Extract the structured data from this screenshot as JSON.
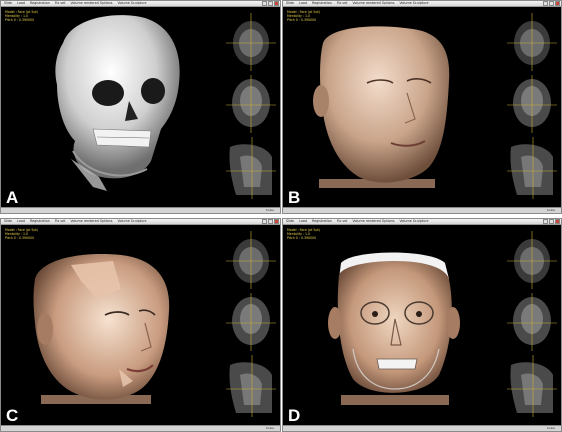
{
  "menu": [
    "Slide",
    "Load",
    "Registration",
    "Fix set",
    "Volume rendered Options",
    "Volume Sculpture"
  ],
  "panels": [
    {
      "id": "A",
      "letter": "A",
      "info": [
        "Model : Face (pt 5pt)",
        "Mentality : 1.0",
        "Pitch 0 : 0.390000"
      ],
      "scale": "Scale"
    },
    {
      "id": "B",
      "letter": "B",
      "info": [
        "Model : Face (pt 5pt)",
        "Mentality : 1.0",
        "Pitch 0 : 0.390000"
      ],
      "scale": "Scale"
    },
    {
      "id": "C",
      "letter": "C",
      "info": [
        "Model : Face (pt 5pt)",
        "Mentality : 1.0",
        "Pitch 0 : 0.390000"
      ],
      "scale": "Scale"
    },
    {
      "id": "D",
      "letter": "D",
      "info": [
        "Model : Face (pt 5pt)",
        "Mentality : 1.0",
        "Pitch 0 : 0.390000"
      ],
      "scale": "Scale"
    }
  ],
  "colors": {
    "background": "#000000",
    "crosshair": "#c9b13a",
    "info_text": "#e8d24a",
    "skin": "#c9a48a",
    "bone": "#e6e6e6"
  }
}
